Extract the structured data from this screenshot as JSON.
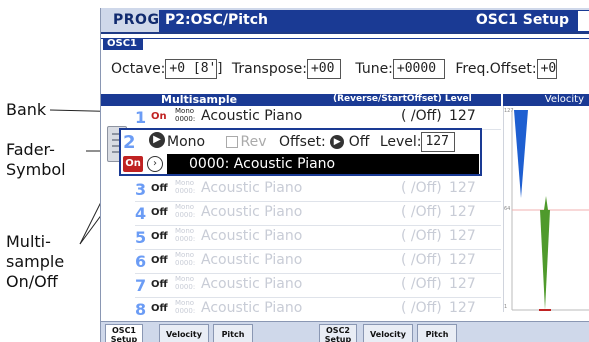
{
  "callouts": {
    "bank": "Bank",
    "fader": "Fader-\nSymbol",
    "multisample": "Multi-\nsample\nOn/Off"
  },
  "header": {
    "mode": "PROG",
    "title": "P2:OSC/Pitch",
    "page": "OSC1 Setup"
  },
  "osc1": {
    "label": "OSC1",
    "octave_label": "Octave:",
    "octave": "+0 [8']",
    "transpose_label": "Transpose:",
    "transpose": "+00",
    "tune_label": "Tune:",
    "tune": "+0000",
    "freq_label": "Freq.Offset:",
    "freq": "+0"
  },
  "table": {
    "h_multisample": "Multisample",
    "h_reverse": "(Reverse/StartOffset) Level",
    "h_velocity": "Velocity"
  },
  "selected": {
    "num": "2",
    "mode": "Mono",
    "rev": "Rev",
    "offset_label": "Offset:",
    "offset": "Off",
    "level_label": "Level:",
    "level": "127",
    "on": "On",
    "sample": "0000: Acoustic Piano"
  },
  "rows": [
    {
      "num": "1",
      "onoff": "On",
      "mono": "Mono\n0000:",
      "name": "Acoustic Piano",
      "off": "(  /Off)",
      "level": "127"
    },
    {
      "num": "3",
      "onoff": "Off",
      "mono": "Mono\n0000:",
      "name": "Acoustic Piano",
      "off": "(  /Off)",
      "level": "127"
    },
    {
      "num": "4",
      "onoff": "Off",
      "mono": "Mono\n0000:",
      "name": "Acoustic Piano",
      "off": "(  /Off)",
      "level": "127"
    },
    {
      "num": "5",
      "onoff": "Off",
      "mono": "Mono\n0000:",
      "name": "Acoustic Piano",
      "off": "(  /Off)",
      "level": "127"
    },
    {
      "num": "6",
      "onoff": "Off",
      "mono": "Mono\n0000:",
      "name": "Acoustic Piano",
      "off": "(  /Off)",
      "level": "127"
    },
    {
      "num": "7",
      "onoff": "Off",
      "mono": "Mono\n0000:",
      "name": "Acoustic Piano",
      "off": "(  /Off)",
      "level": "127"
    },
    {
      "num": "8",
      "onoff": "Off",
      "mono": "Mono\n0000:",
      "name": "Acoustic Piano",
      "off": "(  /Off)",
      "level": "127"
    }
  ],
  "velocity_axis": {
    "top": "127",
    "mid": "64",
    "bottom": "1"
  },
  "tabs": [
    {
      "label": "OSC1\nSetup"
    },
    {
      "label": "Velocity"
    },
    {
      "label": "Pitch"
    },
    {
      "label": "OSC2\nSetup"
    },
    {
      "label": "Velocity"
    },
    {
      "label": "Pitch"
    }
  ],
  "colors": {
    "accent": "#1a3a94",
    "on": "#c02222",
    "bar_blue": "#1e5fd1",
    "bar_green": "#4f9a2c"
  }
}
